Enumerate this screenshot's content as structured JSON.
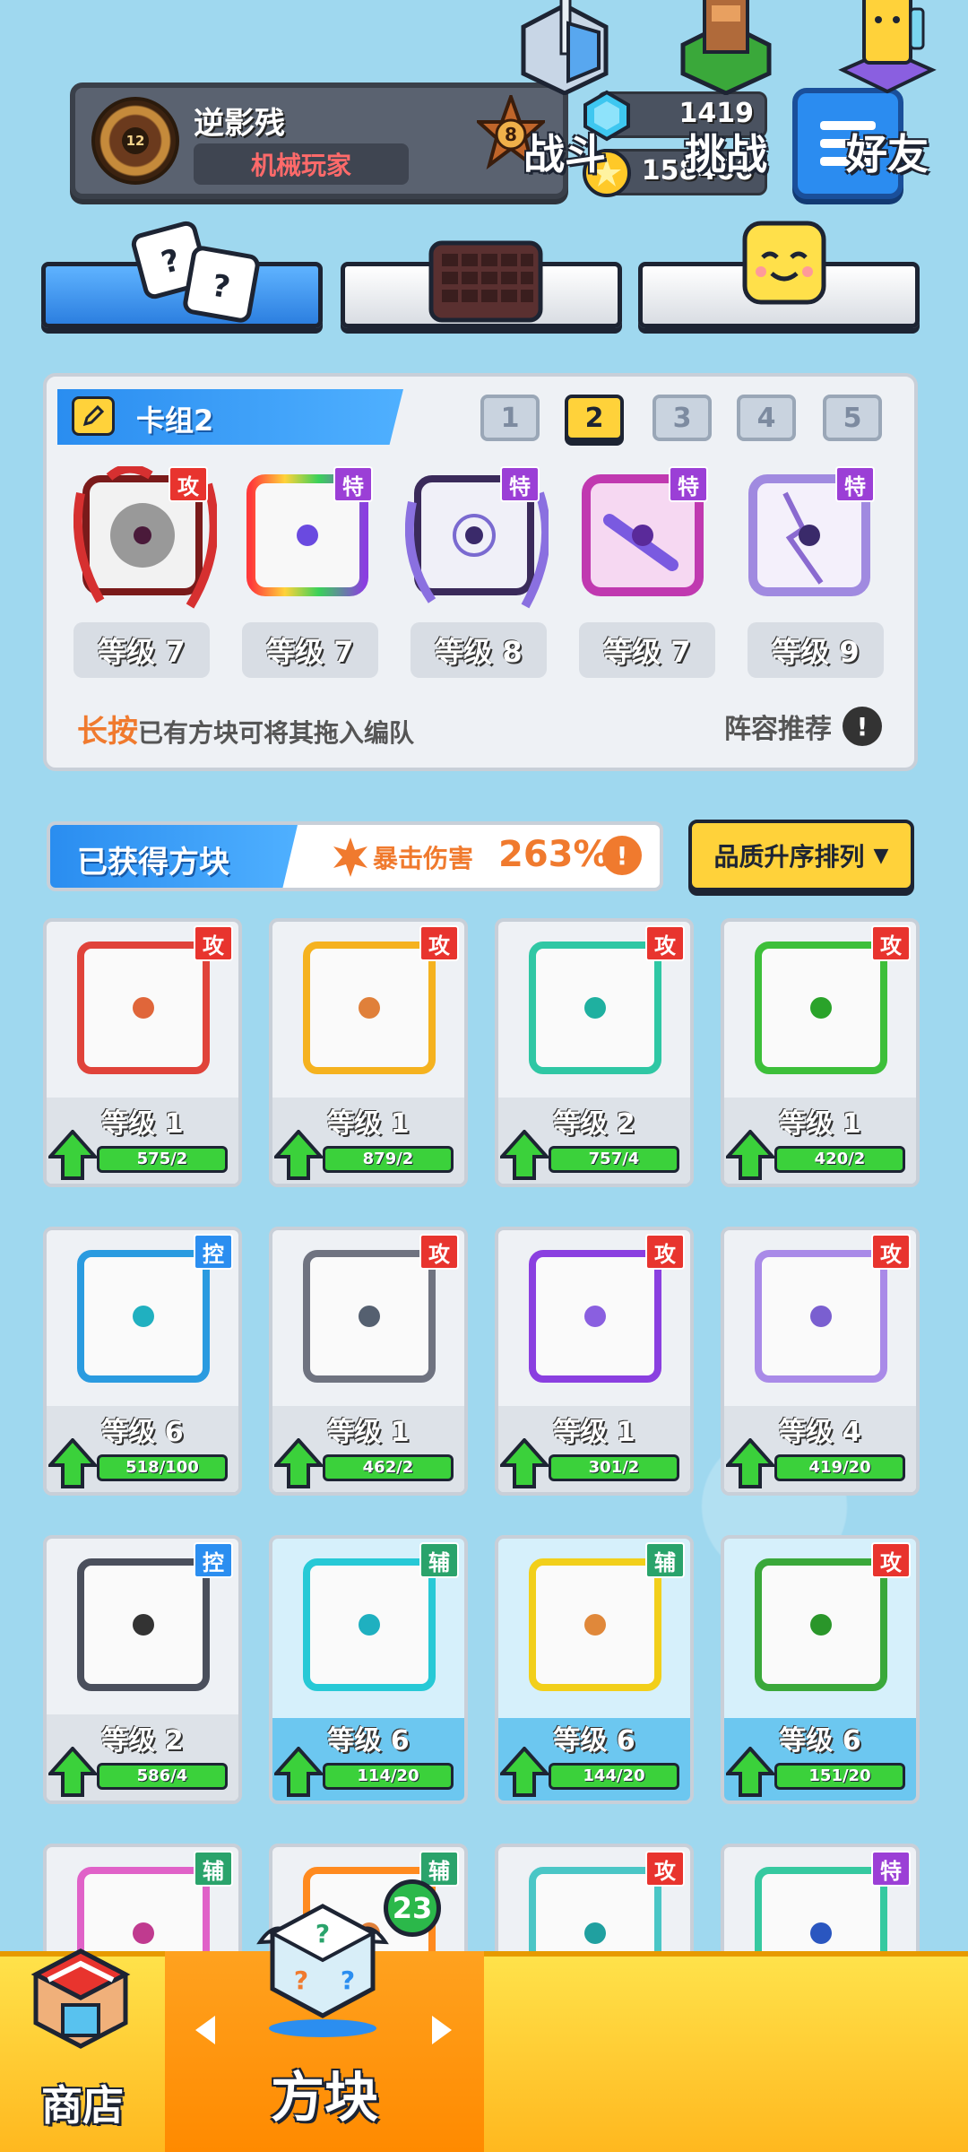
{
  "profile": {
    "name": "逆影残",
    "title": "机械玩家",
    "avatar_level": "12",
    "rank": "8"
  },
  "currency": {
    "gems": "1419",
    "coins": "158400"
  },
  "category_tabs": [
    {
      "name": "dice",
      "active": true
    },
    {
      "name": "board",
      "active": false
    },
    {
      "name": "emoji",
      "active": false
    }
  ],
  "deck": {
    "label": "卡组2",
    "numbers": [
      "1",
      "2",
      "3",
      "4",
      "5"
    ],
    "active_index": 1,
    "cards": [
      {
        "badge": "攻",
        "level": "等级 7",
        "color": "#c0392b"
      },
      {
        "badge": "特",
        "level": "等级 7",
        "color": "#8e44ad"
      },
      {
        "badge": "特",
        "level": "等级 8",
        "color": "#5a3b8f"
      },
      {
        "badge": "特",
        "level": "等级 7",
        "color": "#b039c9"
      },
      {
        "badge": "特",
        "level": "等级 9",
        "color": "#9b59d0"
      }
    ],
    "hint_highlight": "长按",
    "hint_text": "已有方块可将其拖入编队",
    "recommend": "阵容推荐"
  },
  "obtained": {
    "title": "已获得方块",
    "crit_label": "暴击伤害",
    "crit_value": "263%",
    "sort_label": "品质升序排列"
  },
  "badge_colors": {
    "攻": "#e8342e",
    "控": "#2b8ef0",
    "辅": "#2aa36b",
    "特": "#9b3fd6"
  },
  "blocks": [
    {
      "badge": "攻",
      "level": "等级 1",
      "progress": "575/2",
      "frame": "#e0433a",
      "dot": "#e0663a",
      "hl": false
    },
    {
      "badge": "攻",
      "level": "等级 1",
      "progress": "879/2",
      "frame": "#f5b21f",
      "dot": "#e0803a",
      "hl": false
    },
    {
      "badge": "攻",
      "level": "等级 2",
      "progress": "757/4",
      "frame": "#2fc7a4",
      "dot": "#1fb0a0",
      "hl": false
    },
    {
      "badge": "攻",
      "level": "等级 1",
      "progress": "420/2",
      "frame": "#3dbf3a",
      "dot": "#2aa32a",
      "hl": false
    },
    {
      "badge": "控",
      "level": "等级 6",
      "progress": "518/100",
      "frame": "#2a9be0",
      "dot": "#20b0c0",
      "hl": false
    },
    {
      "badge": "攻",
      "level": "等级 1",
      "progress": "462/2",
      "frame": "#6f7380",
      "dot": "#556070",
      "hl": false
    },
    {
      "badge": "攻",
      "level": "等级 1",
      "progress": "301/2",
      "frame": "#8a3fe0",
      "dot": "#8a5fe0",
      "hl": false
    },
    {
      "badge": "攻",
      "level": "等级 4",
      "progress": "419/20",
      "frame": "#a98ae8",
      "dot": "#7a5fd0",
      "hl": false
    },
    {
      "badge": "控",
      "level": "等级 2",
      "progress": "586/4",
      "frame": "#4a4f5c",
      "dot": "#333",
      "hl": false
    },
    {
      "badge": "辅",
      "level": "等级 6",
      "progress": "114/20",
      "frame": "#27c9d6",
      "dot": "#1fb0c0",
      "hl": true
    },
    {
      "badge": "辅",
      "level": "等级 6",
      "progress": "144/20",
      "frame": "#f2cf1a",
      "dot": "#e0883a",
      "hl": true
    },
    {
      "badge": "攻",
      "level": "等级 6",
      "progress": "151/20",
      "frame": "#3aa83a",
      "dot": "#2a962a",
      "hl": true
    },
    {
      "badge": "辅",
      "level": "",
      "progress": "",
      "frame": "#e062c8",
      "dot": "#c03a8f",
      "hl": false
    },
    {
      "badge": "辅",
      "level": "",
      "progress": "",
      "frame": "#ff8a1f",
      "dot": "#e0803a",
      "hl": false
    },
    {
      "badge": "攻",
      "level": "",
      "progress": "",
      "frame": "#4ac6c6",
      "dot": "#20a0a0",
      "hl": false
    },
    {
      "badge": "特",
      "level": "",
      "progress": "",
      "frame": "#36c9a0",
      "dot": "#2a56c0",
      "hl": false
    }
  ],
  "nav": {
    "shop": "商店",
    "blocks": "方块",
    "battle": "战斗",
    "challenge": "挑战",
    "friends": "好友",
    "blocks_count": "23"
  }
}
